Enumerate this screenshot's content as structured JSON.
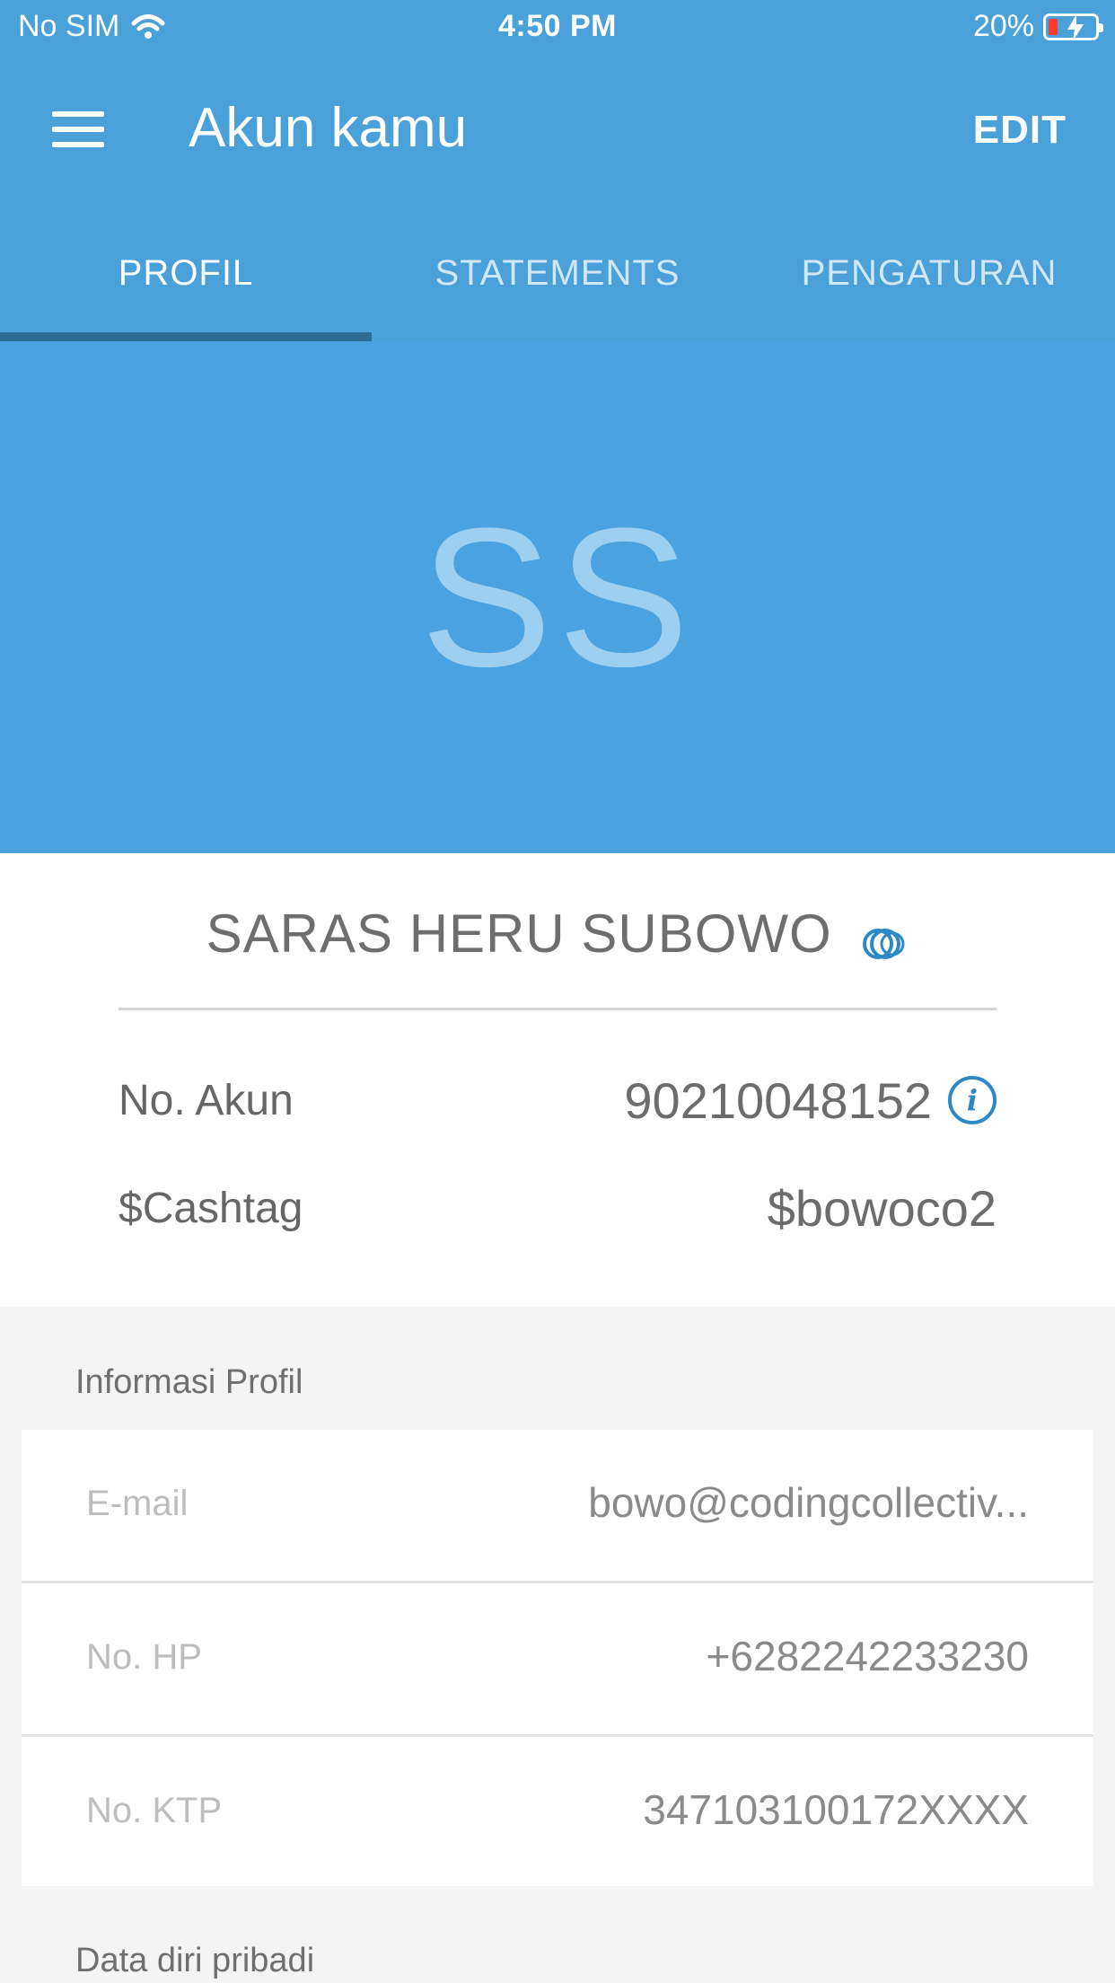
{
  "status_bar": {
    "carrier": "No SIM",
    "time": "4:50 PM",
    "battery": "20%",
    "battery_level": 0.2
  },
  "appbar": {
    "title": "Akun kamu",
    "edit_label": "EDIT"
  },
  "tabs": [
    {
      "label": "PROFIL",
      "active": true
    },
    {
      "label": "STATEMENTS",
      "active": false
    },
    {
      "label": "PENGATURAN",
      "active": false
    }
  ],
  "hero": {
    "initials": "SS"
  },
  "profile_summary": {
    "name": "SARAS HERU SUBOWO",
    "account_label": "No. Akun",
    "account_value": "90210048152",
    "cashtag_label": "$Cashtag",
    "cashtag_value": "$bowoco2"
  },
  "sections": {
    "profile_info_title": "Informasi Profil",
    "personal_data_title": "Data diri pribadi"
  },
  "profile_info": [
    {
      "label": "E-mail",
      "value": "bowo@codingcollectiv..."
    },
    {
      "label": "No. HP",
      "value": "+6282242233230"
    },
    {
      "label": "No. KTP",
      "value": "347103100172XXXX"
    }
  ],
  "colors": {
    "primary": "#4aa1da",
    "hero": "#4aa3e0",
    "tab_indicator": "#2c6b93",
    "info_icon": "#2d89c6"
  }
}
